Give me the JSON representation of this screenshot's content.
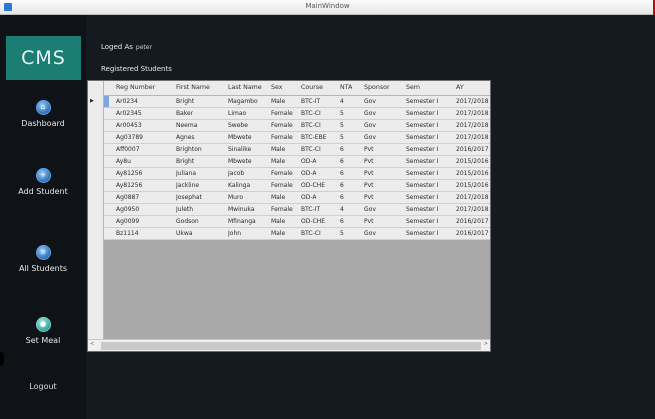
{
  "window": {
    "title": "MainWindow"
  },
  "sidebar": {
    "logo": "CMS",
    "items": [
      {
        "label": "Dashboard",
        "icon": "home-icon",
        "glyph": "⌂"
      },
      {
        "label": "Add Student",
        "icon": "add-student-icon",
        "glyph": "+"
      },
      {
        "label": "All Students",
        "icon": "students-icon",
        "glyph": "≡"
      },
      {
        "label": "Set Meal",
        "icon": "meal-icon",
        "glyph": "●"
      }
    ],
    "logout": "Logout"
  },
  "header": {
    "logged_in_label": "Loged As",
    "username": "peter",
    "section_title": "Registered Students"
  },
  "grid": {
    "columns": [
      "Reg Number",
      "First Name",
      "Last Name",
      "Sex",
      "Course",
      "NTA",
      "Sponsor",
      "Sem",
      "AY"
    ],
    "rows": [
      [
        "Ar0234",
        "Bright",
        "Magambo",
        "Male",
        "BTC-IT",
        "4",
        "Gov",
        "Semester I",
        "2017/2018"
      ],
      [
        "Ar02345",
        "Baker",
        "Limao",
        "Female",
        "BTC-CI",
        "5",
        "Gov",
        "Semester I",
        "2017/2018"
      ],
      [
        "Ar00453",
        "Neema",
        "Swebe",
        "Female",
        "BTC-CI",
        "5",
        "Gov",
        "Semester I",
        "2017/2018"
      ],
      [
        "Ag03789",
        "Agnes",
        "Mbwete",
        "Female",
        "BTC-EBE",
        "5",
        "Gov",
        "Semester I",
        "2017/2018"
      ],
      [
        "Aff0007",
        "Brighton",
        "Sinalike",
        "Male",
        "BTC-CI",
        "6",
        "Pvt",
        "Semester I",
        "2016/2017"
      ],
      [
        "Ay8u",
        "Bright",
        "Mbwete",
        "Male",
        "OD-A",
        "6",
        "Pvt",
        "Semester I",
        "2015/2016"
      ],
      [
        "Ay81256",
        "Juliana",
        "Jacob",
        "Female",
        "OD-A",
        "6",
        "Pvt",
        "Semester I",
        "2015/2016"
      ],
      [
        "Ay81256",
        "Jackline",
        "Kalinga",
        "Female",
        "OD-CHE",
        "6",
        "Pvt",
        "Semester I",
        "2015/2016"
      ],
      [
        "Ag0887",
        "Josephat",
        "Muro",
        "Male",
        "OD-A",
        "6",
        "Pvt",
        "Semester I",
        "2017/2018"
      ],
      [
        "Ag0950",
        "Juleth",
        "Mwinuka",
        "Female",
        "BTC-IT",
        "4",
        "Gov",
        "Semester I",
        "2017/2018"
      ],
      [
        "Ag0099",
        "Godson",
        "Mfinanga",
        "Male",
        "OD-CHE",
        "6",
        "Pvt",
        "Semester I",
        "2016/2017"
      ],
      [
        "Bz1114",
        "Ukwa",
        "John",
        "Male",
        "BTC-CI",
        "5",
        "Gov",
        "Semester I",
        "2016/2017"
      ]
    ]
  },
  "colors": {
    "accent": "#1b7d74",
    "background": "#151a21",
    "sidebar": "#0f1318"
  }
}
